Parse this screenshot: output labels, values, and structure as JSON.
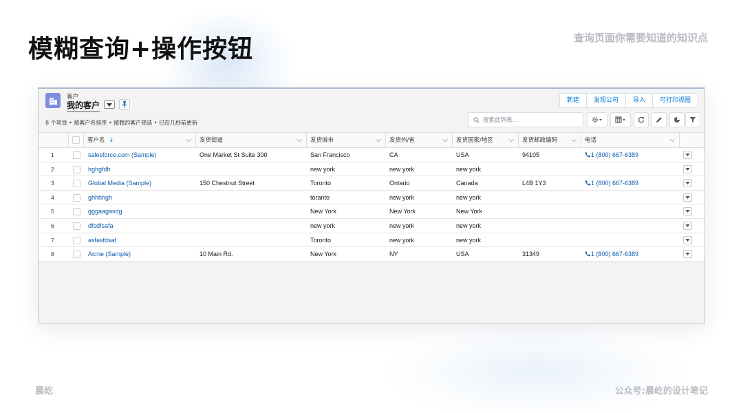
{
  "slide": {
    "title": "模糊查询+操作按钮",
    "subtitle_right": "查询页面你需要知道的知识点",
    "footer_left": "晨屹",
    "footer_right": "公众号:晨屹的设计笔记"
  },
  "list_view": {
    "object_label": "客户",
    "view_name": "我的客户",
    "meta": "8 个项目 • 按客户名排序 • 按我的客户筛选 • 已在几秒前更新",
    "actions": [
      "新建",
      "发现公司",
      "导入",
      "可打印视图"
    ],
    "search_placeholder": "搜索此列表...",
    "toolbar_icons": [
      "gear-icon",
      "table-icon",
      "refresh-icon",
      "edit-icon",
      "chart-icon",
      "filter-icon"
    ]
  },
  "table": {
    "columns": [
      "客户名",
      "发货街道",
      "发货城市",
      "发货州/省",
      "发货国家/地区",
      "发货邮政编码",
      "电话"
    ],
    "sort_indicator": "↓",
    "rows": [
      {
        "n": "1",
        "name": "salesforce.com (Sample)",
        "street": "One Market St Suite 300",
        "city": "San Francisco",
        "state": "CA",
        "country": "USA",
        "zip": "94105",
        "phone": "1 (800) 667-6389"
      },
      {
        "n": "2",
        "name": "hghgfdh",
        "street": "",
        "city": "new york",
        "state": "new york",
        "country": "new york",
        "zip": "",
        "phone": ""
      },
      {
        "n": "3",
        "name": "Global Media (Sample)",
        "street": "150 Chestnut Street",
        "city": "Toronto",
        "state": "Ontario",
        "country": "Canada",
        "zip": "L4B 1Y3",
        "phone": "1 (800) 667-6389"
      },
      {
        "n": "4",
        "name": "ghhhhgh",
        "street": "",
        "city": "toranto",
        "state": "new york",
        "country": "new york",
        "zip": "",
        "phone": ""
      },
      {
        "n": "5",
        "name": "gggaagasdg",
        "street": "",
        "city": "New York",
        "state": "New York",
        "country": "New York",
        "zip": "",
        "phone": ""
      },
      {
        "n": "6",
        "name": "dfsdfsafa",
        "street": "",
        "city": "new york",
        "state": "new york",
        "country": "new york",
        "zip": "",
        "phone": ""
      },
      {
        "n": "7",
        "name": "asfasfdsaf",
        "street": "",
        "city": "Toronto",
        "state": "new york",
        "country": "new york",
        "zip": "",
        "phone": ""
      },
      {
        "n": "8",
        "name": "Acme (Sample)",
        "street": "10 Main Rd.",
        "city": "New York",
        "state": "NY",
        "country": "USA",
        "zip": "31349",
        "phone": "1 (800) 667-6389"
      }
    ]
  },
  "colors": {
    "link": "#0b5cab",
    "accent": "#0176d3",
    "object_icon": "#7f8de1"
  }
}
